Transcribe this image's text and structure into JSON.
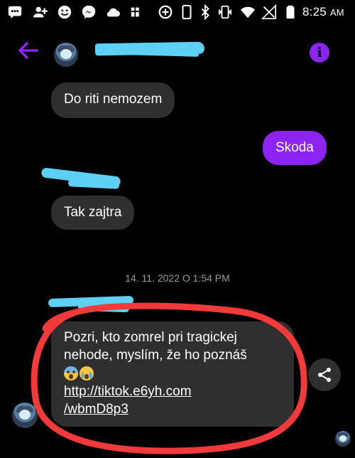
{
  "status_bar": {
    "time": "8:25",
    "ampm": "AM",
    "icons": [
      "chat-bubble-dots-icon",
      "add-person-icon",
      "smiley-icon",
      "messenger-icon",
      "cloud-icon",
      "photo-icon",
      "data-saver-icon",
      "phone-icon",
      "bluetooth-icon",
      "vibrate-icon",
      "wifi-icon",
      "no-signal-icon",
      "battery-icon"
    ]
  },
  "header": {
    "back_icon": "arrow-left-icon",
    "info_label": "i",
    "accent_color": "#8e24f2"
  },
  "messages": [
    {
      "direction": "incoming",
      "text": "Do riti nemozem"
    },
    {
      "direction": "outgoing",
      "text": "Skoda"
    },
    {
      "direction": "incoming",
      "text": "Tak zajtra"
    }
  ],
  "timestamp": "14. 11. 2022 O 1:54 PM",
  "last_message": {
    "line1": "Pozri, kto zomrel pri tragickej",
    "line2": "nehode, myslím, že ho poznáš",
    "emojis": [
      "face-screaming-in-fear",
      "loudly-crying-face"
    ],
    "link_line1": "http://tiktok.e6yh.com",
    "link_line2": "/wbmD8p3"
  },
  "colors": {
    "background": "#000000",
    "incoming_bubble": "#2f2f2f",
    "outgoing_bubble": "#8e24f2",
    "redaction": "#5fd0f5",
    "annotation_circle": "#f23a3a"
  }
}
